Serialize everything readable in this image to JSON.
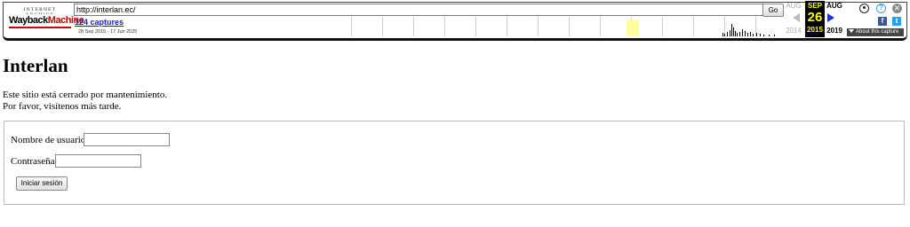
{
  "toolbar": {
    "logo_top": "INTERNET ARCHIVE",
    "logo_main_a": "Wayback",
    "logo_main_b": "Machine",
    "url": "http://interlan.ec/",
    "go_label": "Go",
    "captures_link": "124 captures",
    "date_range": "28 Sep 2015 - 17 Jun 2025",
    "prev_month": "AUG",
    "prev_year": "2014",
    "current_month": "SEP",
    "current_day": "26",
    "current_year": "2015",
    "next_month": "AUG",
    "next_year": "2019",
    "about_label": "About this capture",
    "help_glyph": "?",
    "close_glyph": "✕",
    "facebook_glyph": "f",
    "twitter_glyph": "t",
    "icons": [
      "user-icon",
      "help-icon",
      "close-icon",
      "facebook-icon",
      "twitter-icon"
    ],
    "colors": {
      "current_bg": "#000000",
      "current_fg": "#ffff00",
      "link": "#1a1ad0",
      "next_arrow": "#2233d8"
    }
  },
  "page": {
    "title": "Interlan",
    "message_line1": "Este sitio está cerrado por mantenimiento.",
    "message_line2": "Por favor, visítenos más tarde.",
    "username_label": "Nombre de usuario",
    "username_value": "",
    "password_label": "Contraseña",
    "password_value": "",
    "login_button": "Iniciar sesión"
  }
}
